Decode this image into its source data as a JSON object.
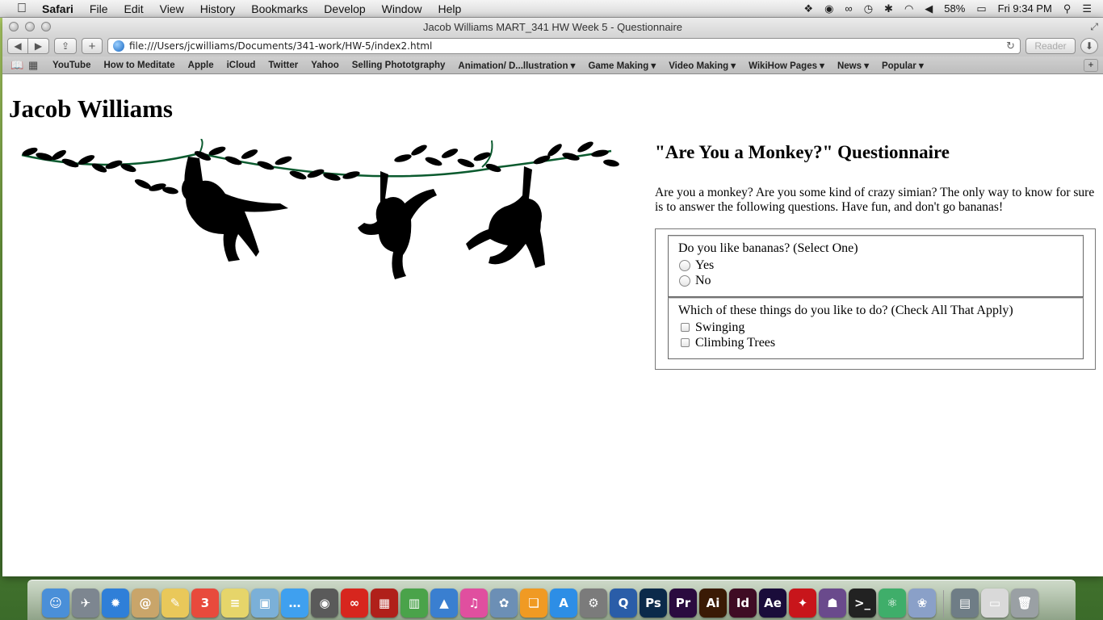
{
  "menubar": {
    "app": "Safari",
    "items": [
      "File",
      "Edit",
      "View",
      "History",
      "Bookmarks",
      "Develop",
      "Window",
      "Help"
    ],
    "battery": "58%",
    "clock": "Fri 9:34 PM"
  },
  "window": {
    "title": "Jacob Williams MART_341 HW Week 5 - Questionnaire",
    "url": "file:///Users/jcwilliams/Documents/341-work/HW-5/index2.html",
    "reader_label": "Reader"
  },
  "bookmarks": [
    {
      "label": "YouTube"
    },
    {
      "label": "How to Meditate"
    },
    {
      "label": "Apple"
    },
    {
      "label": "iCloud"
    },
    {
      "label": "Twitter"
    },
    {
      "label": "Yahoo"
    },
    {
      "label": "Selling Phototgraphy"
    },
    {
      "label": "Animation/ D...llustration ▾"
    },
    {
      "label": "Game Making ▾"
    },
    {
      "label": "Video Making ▾"
    },
    {
      "label": "WikiHow Pages ▾"
    },
    {
      "label": "News ▾"
    },
    {
      "label": "Popular ▾"
    }
  ],
  "page": {
    "heading": "Jacob Williams",
    "quiz_title": "\"Are You a Monkey?\" Questionnaire",
    "intro": "Are you a monkey? Are you some kind of crazy simian? The only way to know for sure is to answer the following questions. Have fun, and don't go bananas!",
    "q1": {
      "question": "Do you like bananas? (Select One)",
      "options": [
        "Yes",
        "No"
      ]
    },
    "q2": {
      "question": "Which of these things do you like to do? (Check All That Apply)",
      "options": [
        "Swinging",
        "Climbing Trees"
      ]
    }
  },
  "dock": [
    {
      "icon": "finder-icon",
      "glyph": "☺",
      "color": "#4a8fd8"
    },
    {
      "icon": "launchpad-icon",
      "glyph": "✈",
      "color": "#7d8690"
    },
    {
      "icon": "safari-icon",
      "glyph": "✹",
      "color": "#2f7fd8"
    },
    {
      "icon": "contacts-icon",
      "glyph": "@",
      "color": "#c9a56a"
    },
    {
      "icon": "textedit-icon",
      "glyph": "✎",
      "color": "#e9c85a"
    },
    {
      "icon": "calendar-icon",
      "glyph": "3",
      "color": "#e84a3c"
    },
    {
      "icon": "notes-icon",
      "glyph": "≡",
      "color": "#e6d56a"
    },
    {
      "icon": "preview-icon",
      "glyph": "▣",
      "color": "#7bb0d8"
    },
    {
      "icon": "messages-icon",
      "glyph": "…",
      "color": "#3fa0ef"
    },
    {
      "icon": "facetime-icon",
      "glyph": "◉",
      "color": "#5a5a5a"
    },
    {
      "icon": "creative-cloud-icon",
      "glyph": "∞",
      "color": "#d7261e"
    },
    {
      "icon": "photo-booth-icon",
      "glyph": "▦",
      "color": "#b0201a"
    },
    {
      "icon": "numbers-icon",
      "glyph": "▥",
      "color": "#4aa34a"
    },
    {
      "icon": "keynote-icon",
      "glyph": "▲",
      "color": "#3a7fd0"
    },
    {
      "icon": "itunes-icon",
      "glyph": "♫",
      "color": "#e04f9f"
    },
    {
      "icon": "iphoto-icon",
      "glyph": "✿",
      "color": "#6c8fb5"
    },
    {
      "icon": "ibooks-icon",
      "glyph": "❏",
      "color": "#f09a23"
    },
    {
      "icon": "app-store-icon",
      "glyph": "A",
      "color": "#2d8ee6"
    },
    {
      "icon": "system-preferences-icon",
      "glyph": "⚙",
      "color": "#7b7b7b"
    },
    {
      "icon": "quicktime-icon",
      "glyph": "Q",
      "color": "#2a5da8"
    },
    {
      "icon": "photoshop-icon",
      "glyph": "Ps",
      "color": "#0b2a4a"
    },
    {
      "icon": "premiere-icon",
      "glyph": "Pr",
      "color": "#2a0b3f"
    },
    {
      "icon": "illustrator-icon",
      "glyph": "Ai",
      "color": "#3a1a05"
    },
    {
      "icon": "indesign-icon",
      "glyph": "Id",
      "color": "#3f0c24"
    },
    {
      "icon": "after-effects-icon",
      "glyph": "Ae",
      "color": "#1a0c3a"
    },
    {
      "icon": "acrobat-icon",
      "glyph": "✦",
      "color": "#c8151b"
    },
    {
      "icon": "github-icon",
      "glyph": "☗",
      "color": "#6a4a8c"
    },
    {
      "icon": "terminal-icon",
      "glyph": ">_",
      "color": "#222222"
    },
    {
      "icon": "atom-icon",
      "glyph": "⚛",
      "color": "#3fae6a"
    },
    {
      "icon": "photos-icon",
      "glyph": "❀",
      "color": "#8aa0c8"
    },
    {
      "icon": "downloads-stack-icon",
      "glyph": "▤",
      "color": "#6f7d86"
    },
    {
      "icon": "documents-stack-icon",
      "glyph": "▭",
      "color": "#d9d9d9"
    },
    {
      "icon": "trash-icon",
      "glyph": "🗑",
      "color": "#9aa0a4"
    }
  ]
}
